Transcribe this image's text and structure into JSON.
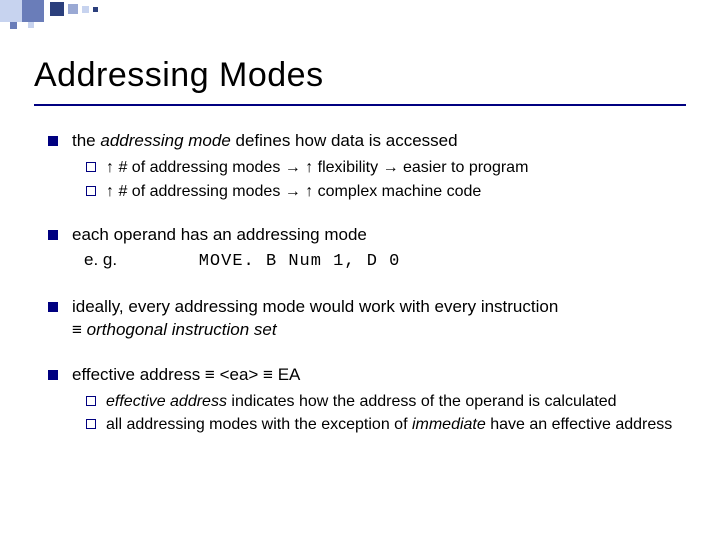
{
  "title": "Addressing Modes",
  "bullets": {
    "b1": {
      "pre": "the ",
      "em": "addressing mode",
      "post": " defines how data is accessed",
      "subs": {
        "s1": "↑ # of addressing modes → ↑ flexibility → easier to program",
        "s2": "↑ # of addressing modes → ↑ complex machine code"
      }
    },
    "b2": {
      "text": "each operand has an addressing mode",
      "example_label": "e. g.",
      "example_code": "MOVE. B   Num 1, D 0"
    },
    "b3": {
      "line1": "ideally, every addressing mode would work with every instruction",
      "line2_pre": "≡ ",
      "line2_em": "orthogonal instruction set"
    },
    "b4": {
      "text": "effective address ≡ <ea> ≡ EA",
      "subs": {
        "s1_em": "effective address",
        "s1_post": " indicates how the address of the operand is calculated",
        "s2_pre": "all addressing modes with the exception of ",
        "s2_em": "immediate",
        "s2_post": " have an effective address"
      }
    }
  }
}
